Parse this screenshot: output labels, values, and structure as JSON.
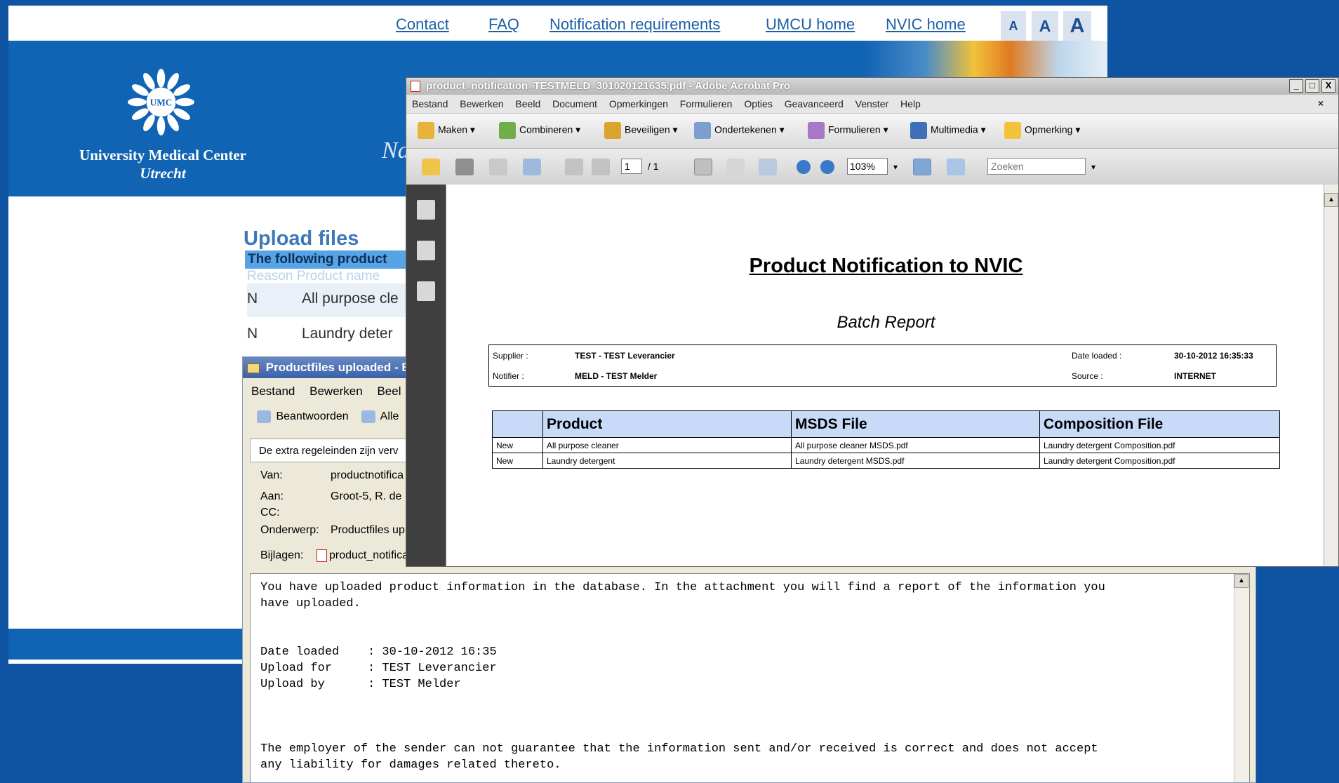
{
  "web": {
    "nav": [
      "Contact",
      "FAQ",
      "Notification requirements",
      "UMCU home",
      "NVIC home"
    ],
    "font_sizes": [
      "A",
      "A",
      "A"
    ],
    "logo_text": "UMC",
    "org_line1": "University Medical Center",
    "org_line2": "Utrecht",
    "banner_partial": "Na",
    "upload_title": "Upload files",
    "upload_subtitle": "The following product",
    "table_head": "Reason  Product name",
    "rows": [
      {
        "reason": "N",
        "product": "All purpose cle"
      },
      {
        "reason": "N",
        "product": "Laundry deter"
      }
    ]
  },
  "mail": {
    "title": "Productfiles uploaded - B",
    "menu": [
      "Bestand",
      "Bewerken",
      "Beel"
    ],
    "tools": [
      "Beantwoorden",
      "Alle"
    ],
    "info_bar": "De extra regeleinden zijn verv",
    "headers": [
      {
        "label": "Van:",
        "value": "productnotifica"
      },
      {
        "label": "Aan:",
        "value": "Groot-5, R. de"
      },
      {
        "label": "CC:",
        "value": ""
      },
      {
        "label": "Onderwerp:",
        "value": "Productfiles up"
      },
      {
        "label": "Bijlagen:",
        "value": "product_notificat"
      }
    ],
    "body": "You have uploaded product information in the database. In the attachment you will find a report of the information you\nhave uploaded.\n\n\nDate loaded    : 30-10-2012 16:35\nUpload for     : TEST Leverancier\nUpload by      : TEST Melder\n\n\n\nThe employer of the sender can not guarantee that the information sent and/or received is correct and does not accept\nany liability for damages related thereto."
  },
  "acrobat": {
    "title": "product_notification_TESTMELD_301020121635.pdf - Adobe Acrobat Pro",
    "window_buttons": [
      "_",
      "□",
      "X"
    ],
    "menu": [
      "Bestand",
      "Bewerken",
      "Beeld",
      "Document",
      "Opmerkingen",
      "Formulieren",
      "Opties",
      "Geavanceerd",
      "Venster",
      "Help"
    ],
    "close_doc": "×",
    "toolbar1": [
      {
        "label": "Maken",
        "icon": "create-icon",
        "color": "#e7b33a"
      },
      {
        "label": "Combineren",
        "icon": "combine-icon",
        "color": "#6fae4b"
      },
      {
        "label": "Beveiligen",
        "icon": "lock-icon",
        "color": "#d9a52c"
      },
      {
        "label": "Ondertekenen",
        "icon": "pen-icon",
        "color": "#7e9ed0"
      },
      {
        "label": "Formulieren",
        "icon": "form-icon",
        "color": "#a678c6"
      },
      {
        "label": "Multimedia",
        "icon": "film-icon",
        "color": "#3f6fb8"
      },
      {
        "label": "Opmerking",
        "icon": "comment-icon",
        "color": "#f2c33a"
      }
    ],
    "page_current": "1",
    "page_total": "/ 1",
    "zoom": "103%",
    "search_placeholder": "Zoeken",
    "doc": {
      "title": "Product Notification to NVIC",
      "subtitle": "Batch Report",
      "supplier_label": "Supplier :",
      "supplier": "TEST - TEST Leverancier",
      "notifier_label": "Notifier :",
      "notifier": "MELD - TEST Melder",
      "date_label": "Date loaded :",
      "date": "30-10-2012 16:35:33",
      "source_label": "Source :",
      "source": "INTERNET",
      "table_headers": [
        "",
        "Product",
        "MSDS File",
        "Composition File"
      ],
      "rows": [
        [
          "New",
          "All purpose cleaner",
          "All purpose cleaner MSDS.pdf",
          "Laundry detergent Composition.pdf"
        ],
        [
          "New",
          "Laundry detergent",
          "Laundry detergent MSDS.pdf",
          "Laundry detergent Composition.pdf"
        ]
      ]
    }
  }
}
